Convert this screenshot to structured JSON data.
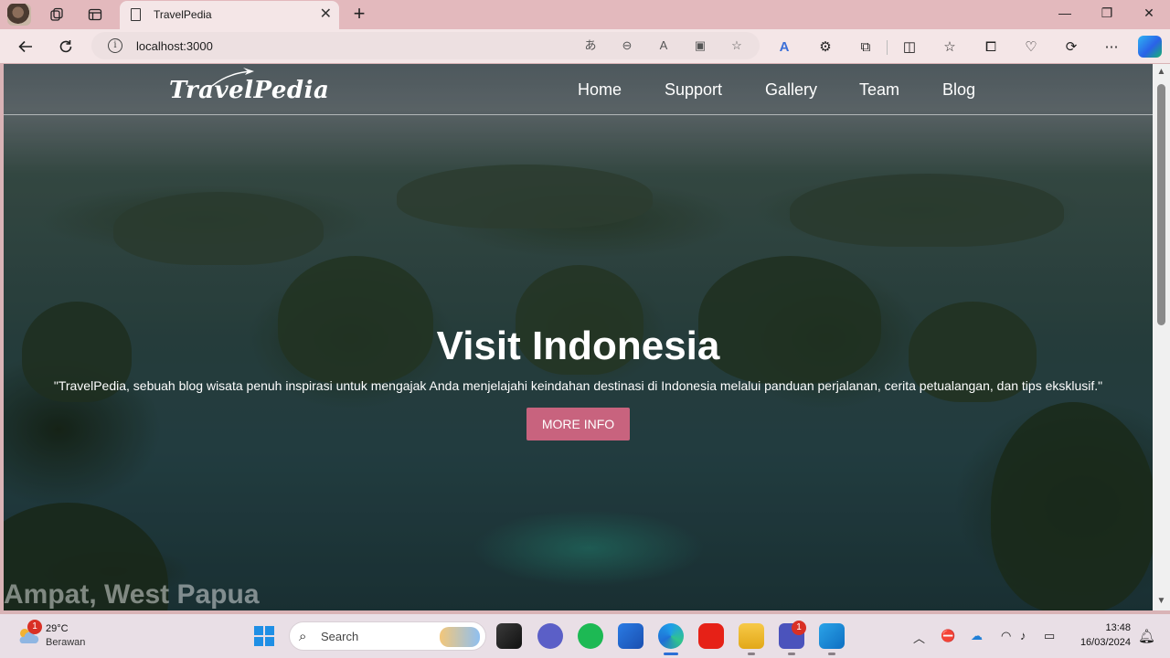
{
  "browser": {
    "tab_title": "TravelPedia",
    "url": "localhost:3000"
  },
  "site": {
    "logo": "TravelPedia",
    "nav": [
      "Home",
      "Support",
      "Gallery",
      "Team",
      "Blog"
    ],
    "hero_title": "Visit Indonesia",
    "hero_subtitle": "\"TravelPedia, sebuah blog wisata penuh inspirasi untuk mengajak Anda menjelajahi keindahan destinasi di Indonesia melalui panduan perjalanan, cerita petualangan, dan tips eksklusif.\"",
    "more_info_label": "MORE INFO",
    "caption": "Ampat, West Papua",
    "accent_color": "#c8637e"
  },
  "taskbar": {
    "weather_temp": "29°C",
    "weather_desc": "Berawan",
    "weather_badge": "1",
    "search_placeholder": "Search",
    "teams_badge": "1",
    "time": "13:48",
    "date": "16/03/2024"
  }
}
